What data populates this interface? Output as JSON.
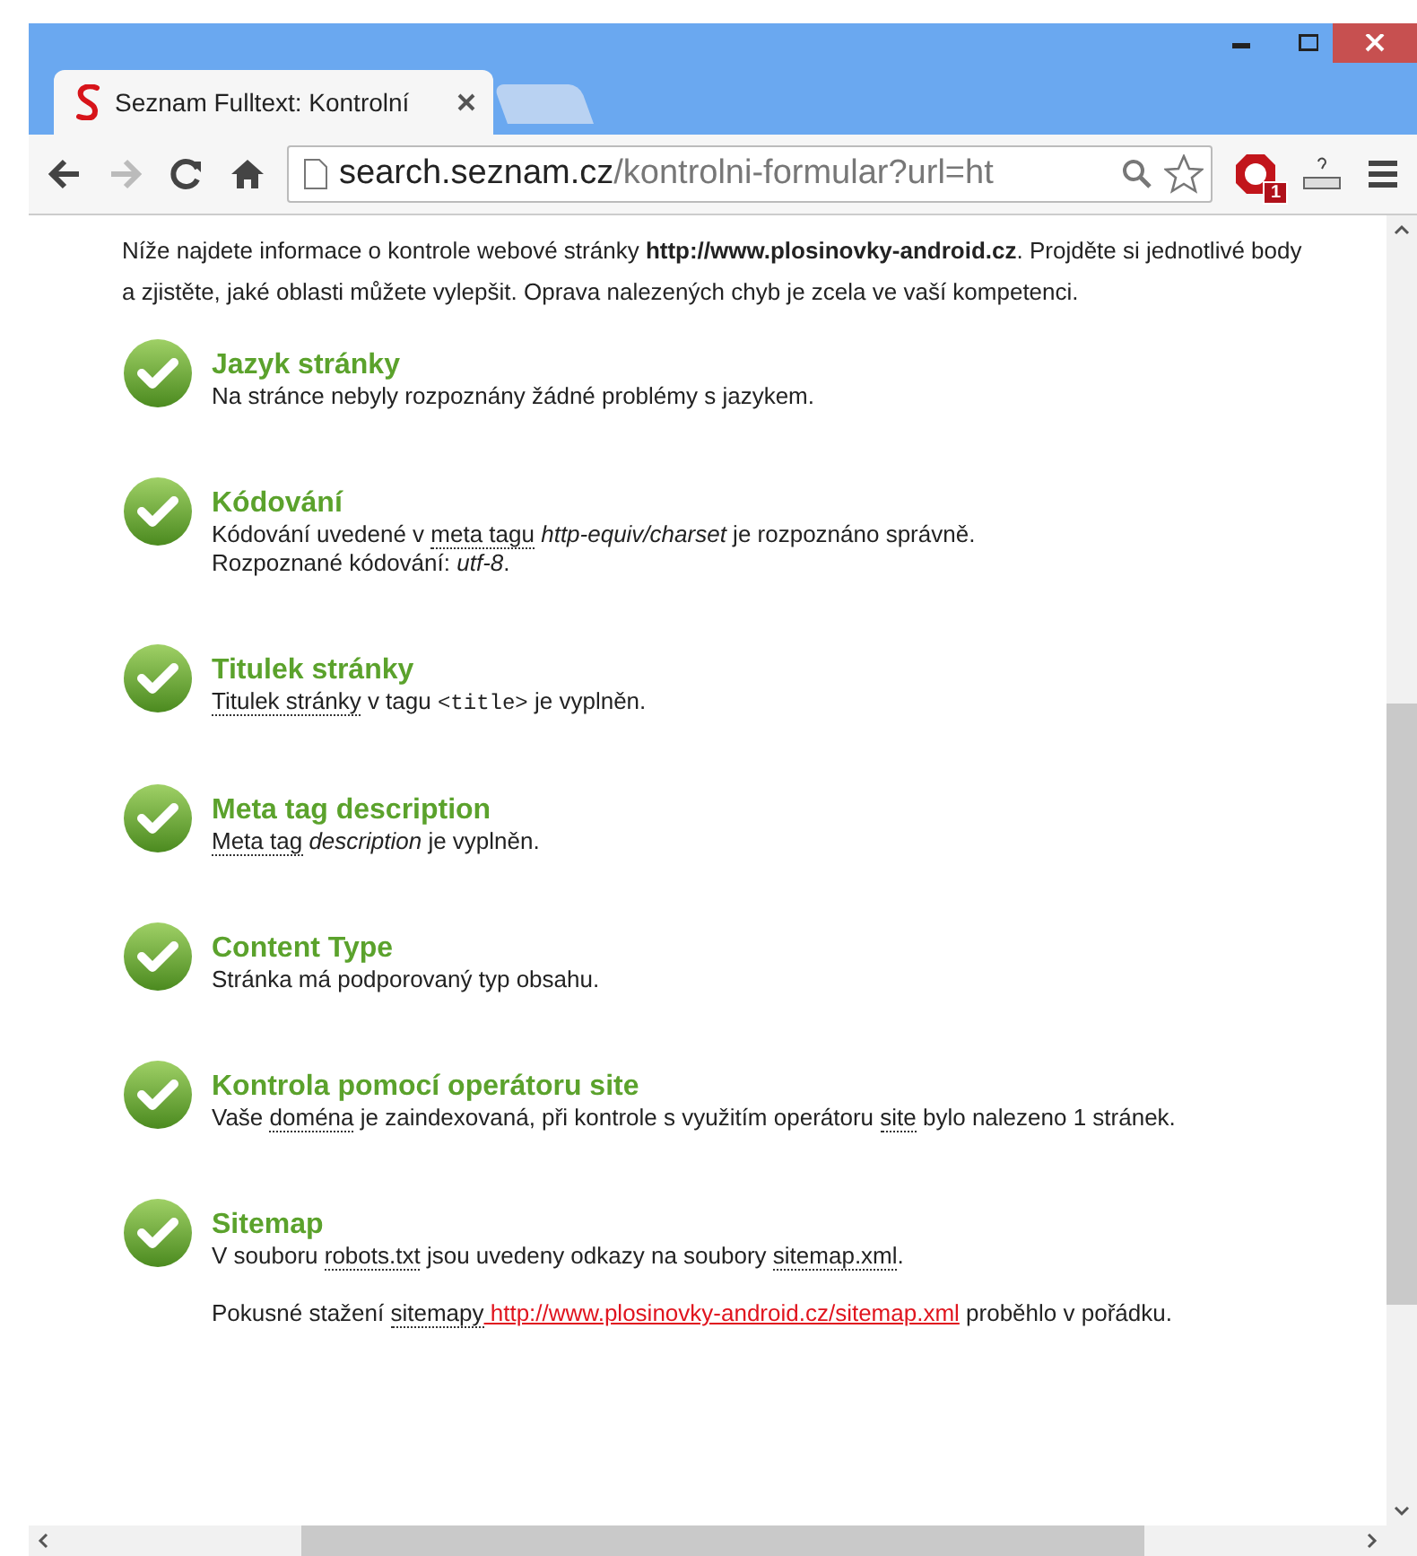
{
  "tabs": [
    {
      "title": "Seznam Fulltext: Kontrolní",
      "selected": true
    },
    {
      "selected": false
    }
  ],
  "address_bar": {
    "host": "search.seznam.cz",
    "path": "/kontrolni-formular?url=ht"
  },
  "extension_badge": "1",
  "intro": "Níže najdete informace o kontrole webové stránky **http://www.plosinovky-android.cz**. Projděte si jednotlivé body a zjistěte, jaké oblasti můžete vylepšit. Oprava nalezených chyb je zcela ve vaší kompetenci.",
  "checks": [
    {
      "title": "Jazyk stránky",
      "passed": true,
      "paragraphs": [
        [
          {
            "kind": "plain",
            "text": "Na stránce nebyly rozpoznány žádné problémy s jazykem."
          }
        ]
      ]
    },
    {
      "title": "Kódování",
      "passed": true,
      "paragraphs": [
        [
          {
            "kind": "plain",
            "text": "Kódování uvedené v "
          },
          {
            "kind": "term",
            "text": "meta tagu"
          },
          {
            "kind": "italic",
            "text": " http-equiv/charset"
          },
          {
            "kind": "plain",
            "text": " je rozpoznáno správně."
          },
          {
            "kind": "break"
          },
          {
            "kind": "plain",
            "text": "Rozpoznané kódování: "
          },
          {
            "kind": "italic",
            "text": "utf-8"
          },
          {
            "kind": "plain",
            "text": "."
          }
        ]
      ]
    },
    {
      "title": "Titulek stránky",
      "passed": true,
      "paragraphs": [
        [
          {
            "kind": "term",
            "text": "Titulek stránky"
          },
          {
            "kind": "plain",
            "text": " v tagu "
          },
          {
            "kind": "code",
            "text": "<title>"
          },
          {
            "kind": "plain",
            "text": " je vyplněn."
          }
        ]
      ]
    },
    {
      "title": "Meta tag description",
      "passed": true,
      "paragraphs": [
        [
          {
            "kind": "term",
            "text": "Meta tag"
          },
          {
            "kind": "italic",
            "text": " description"
          },
          {
            "kind": "plain",
            "text": " je vyplněn."
          }
        ]
      ]
    },
    {
      "title": "Content Type",
      "passed": true,
      "paragraphs": [
        [
          {
            "kind": "plain",
            "text": "Stránka má podporovaný typ obsahu."
          }
        ]
      ]
    },
    {
      "title": "Kontrola pomocí operátoru site",
      "passed": true,
      "paragraphs": [
        [
          {
            "kind": "plain",
            "text": "Vaše "
          },
          {
            "kind": "term",
            "text": "doména"
          },
          {
            "kind": "plain",
            "text": " je zaindexovaná, při kontrole s využitím operátoru "
          },
          {
            "kind": "term",
            "text": "site"
          },
          {
            "kind": "plain",
            "text": " bylo nalezeno 1 stránek."
          }
        ]
      ]
    },
    {
      "title": "Sitemap",
      "passed": true,
      "paragraphs": [
        [
          {
            "kind": "plain",
            "text": "V souboru "
          },
          {
            "kind": "term",
            "text": "robots.txt"
          },
          {
            "kind": "plain",
            "text": " jsou uvedeny odkazy na soubory "
          },
          {
            "kind": "term",
            "text": "sitemap.xml"
          },
          {
            "kind": "plain",
            "text": "."
          }
        ],
        [
          {
            "kind": "plain",
            "text": "Pokusné stažení "
          },
          {
            "kind": "term",
            "text": "sitemapy"
          },
          {
            "kind": "link",
            "text": " http://www.plosinovky-android.cz/sitemap.xml"
          },
          {
            "kind": "plain",
            "text": " proběhlo v pořádku."
          }
        ]
      ]
    }
  ]
}
